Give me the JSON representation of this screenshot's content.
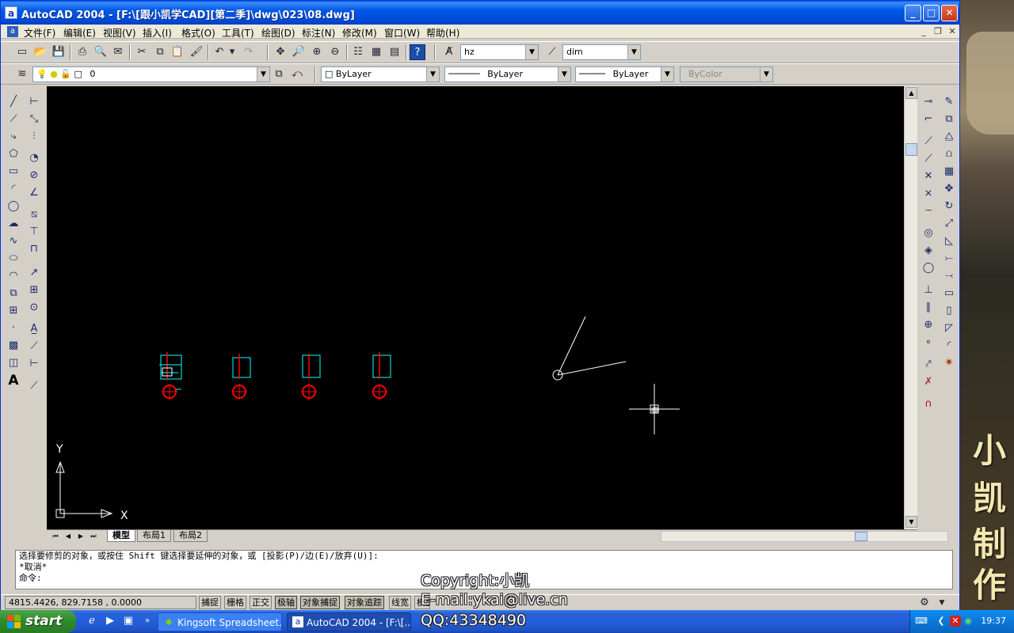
{
  "window": {
    "title": "AutoCAD 2004 - [F:\\[跟小凯学CAD][第二季]\\dwg\\023\\08.dwg]",
    "app_icon": "a",
    "minimize": "_",
    "maximize": "□",
    "close": "✕"
  },
  "menu": [
    "文件(F)",
    "编辑(E)",
    "视图(V)",
    "插入(I)",
    "格式(O)",
    "工具(T)",
    "绘图(D)",
    "标注(N)",
    "修改(M)",
    "窗口(W)",
    "帮助(H)"
  ],
  "toolbar": {
    "text_style": "hz",
    "dim_style": "dim",
    "layer": "0",
    "color": "ByLayer",
    "linetype": "ByLayer",
    "lineweight": "ByLayer",
    "plotstyle": "ByColor"
  },
  "layout_tabs": [
    "模型",
    "布局1",
    "布局2"
  ],
  "command_lines": [
    "选择要修剪的对象，或按住 Shift 键选择要延伸的对象，或 [投影(P)/边(E)/放弃(U)]:",
    "*取消*",
    "命令:"
  ],
  "status": {
    "coords": "4815.4426, 829.7158 , 0.0000",
    "buttons": [
      "捕捉",
      "栅格",
      "正交",
      "极轴",
      "对象捕捉",
      "对象追踪",
      "线宽",
      "模型"
    ]
  },
  "ucs": {
    "x_label": "X",
    "y_label": "Y"
  },
  "overlay": {
    "copyright": "Copyright:小凯",
    "email": "E-mail:ykai@live.cn",
    "qq": "QQ:43348490"
  },
  "wallpaper_chars": [
    "小",
    "凯",
    "制",
    "作"
  ],
  "taskbar": {
    "start": "start",
    "tasks": [
      {
        "label": "Kingsoft Spreadsheet...",
        "icon": "spreadsheet-icon"
      },
      {
        "label": "AutoCAD 2004 - [F:\\[...",
        "icon": "autocad-icon"
      }
    ],
    "clock": "19:37"
  },
  "colors": {
    "canvas_bg": "#000000",
    "title_bar": "#0058e6",
    "taskbar": "#245edb",
    "entity_red": "#ff0000",
    "entity_cyan": "#00ffff",
    "entity_white": "#ffffff"
  }
}
